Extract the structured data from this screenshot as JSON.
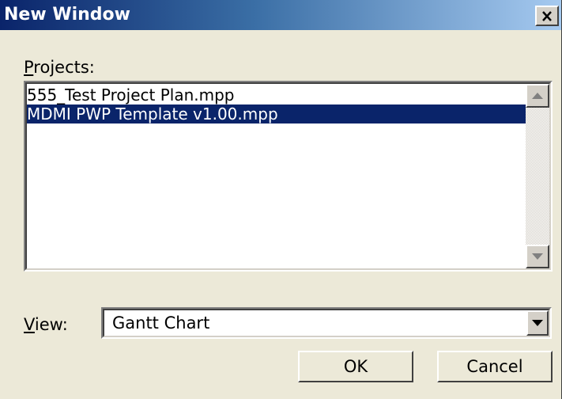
{
  "window": {
    "title": "New Window",
    "close_icon": "close-icon"
  },
  "projects": {
    "label_prefix": "",
    "label_access": "P",
    "label_rest": "rojects:",
    "items": [
      {
        "label": "555_Test Project Plan.mpp",
        "selected": false
      },
      {
        "label": "MDMI PWP Template v1.00.mpp",
        "selected": true
      }
    ]
  },
  "view": {
    "label_access": "V",
    "label_rest": "iew:",
    "selected_value": "Gantt Chart"
  },
  "buttons": {
    "ok": "OK",
    "cancel": "Cancel"
  },
  "colors": {
    "title_bar_start": "#0a246a",
    "title_bar_end": "#a6caf0",
    "dialog_background": "#ece9d8",
    "selection": "#0a246a"
  }
}
